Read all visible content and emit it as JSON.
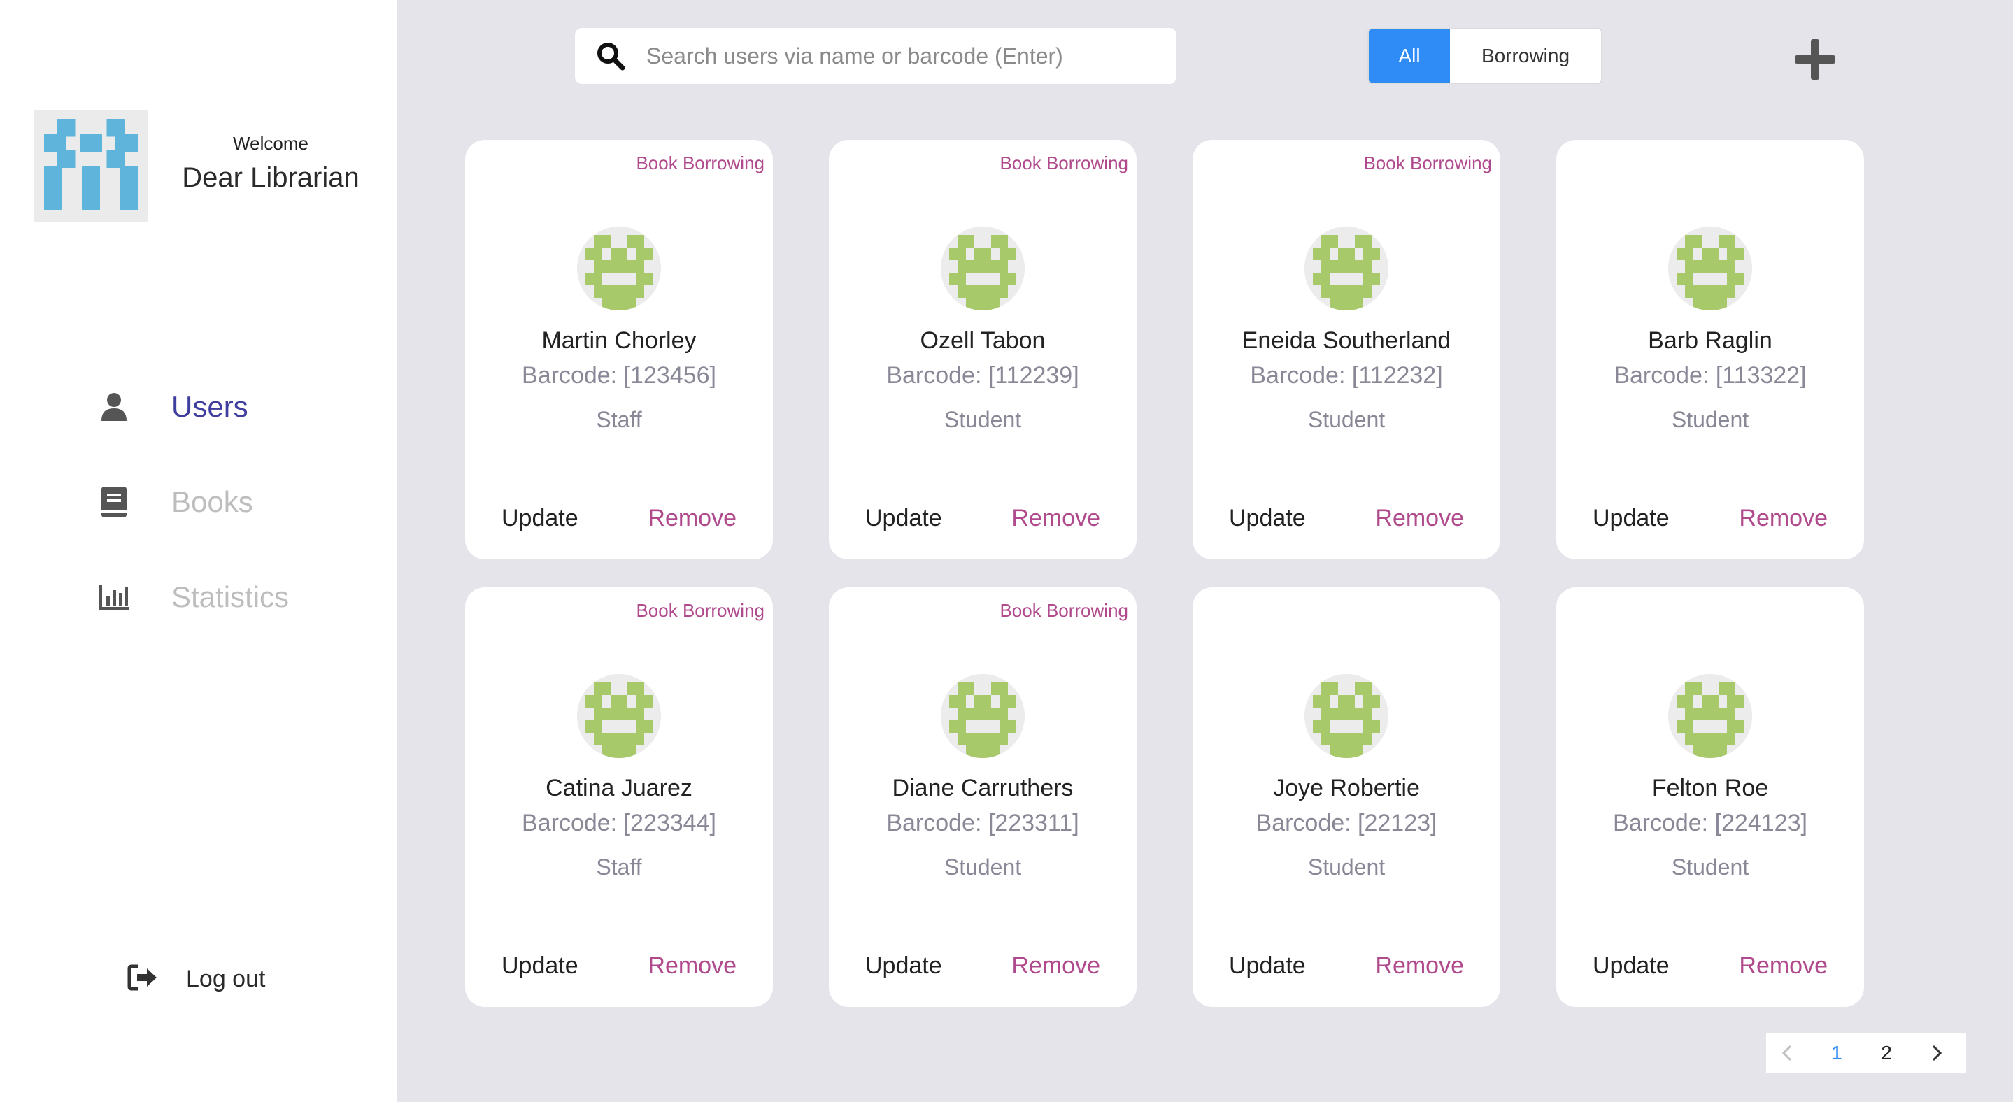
{
  "sidebar": {
    "welcome": "Welcome",
    "user_name": "Dear Librarian",
    "nav": [
      {
        "label": "Users",
        "icon": "user-icon",
        "active": true
      },
      {
        "label": "Books",
        "icon": "book-icon",
        "active": false
      },
      {
        "label": "Statistics",
        "icon": "bar-chart-icon",
        "active": false
      }
    ],
    "logout_label": "Log out"
  },
  "search": {
    "placeholder": "Search users via name or barcode (Enter)",
    "value": ""
  },
  "filter": {
    "options": [
      "All",
      "Borrowing"
    ],
    "selected": "All"
  },
  "cards": [
    {
      "badge": "Book Borrowing",
      "name": "Martin Chorley",
      "barcode": "Barcode: [123456]",
      "role": "Staff",
      "update": "Update",
      "remove": "Remove"
    },
    {
      "badge": "Book Borrowing",
      "name": "Ozell Tabon",
      "barcode": "Barcode: [112239]",
      "role": "Student",
      "update": "Update",
      "remove": "Remove"
    },
    {
      "badge": "Book Borrowing",
      "name": "Eneida Southerland",
      "barcode": "Barcode: [112232]",
      "role": "Student",
      "update": "Update",
      "remove": "Remove"
    },
    {
      "badge": "",
      "name": "Barb Raglin",
      "barcode": "Barcode: [113322]",
      "role": "Student",
      "update": "Update",
      "remove": "Remove"
    },
    {
      "badge": "Book Borrowing",
      "name": "Catina Juarez",
      "barcode": "Barcode: [223344]",
      "role": "Staff",
      "update": "Update",
      "remove": "Remove"
    },
    {
      "badge": "Book Borrowing",
      "name": "Diane Carruthers",
      "barcode": "Barcode: [223311]",
      "role": "Student",
      "update": "Update",
      "remove": "Remove"
    },
    {
      "badge": "",
      "name": "Joye Robertie",
      "barcode": "Barcode: [22123]",
      "role": "Student",
      "update": "Update",
      "remove": "Remove"
    },
    {
      "badge": "",
      "name": "Felton Roe",
      "barcode": "Barcode: [224123]",
      "role": "Student",
      "update": "Update",
      "remove": "Remove"
    }
  ],
  "pagination": {
    "pages": [
      "1",
      "2"
    ],
    "current": "1",
    "prev_icon": "chevron-left-icon",
    "next_icon": "chevron-right-icon"
  },
  "colors": {
    "accent_blue": "#2f8bf5",
    "active_nav": "#3f3d9e",
    "remove_pink": "#b04a8c",
    "avatar_green": "#a8c96a",
    "logo_blue": "#5fb4dc",
    "background": "#e4e4ea"
  }
}
